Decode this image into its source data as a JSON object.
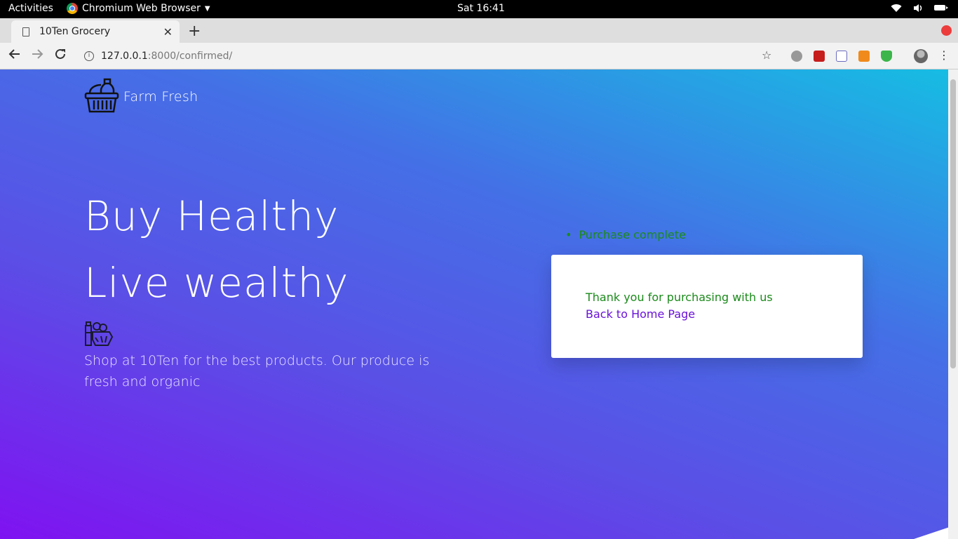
{
  "os_bar": {
    "activities": "Activities",
    "app_name": "Chromium Web Browser",
    "clock": "Sat 16:41"
  },
  "browser": {
    "tab_title": "10Ten Grocery",
    "url_host": "127.0.0.1",
    "url_path": ":8000/confirmed/"
  },
  "page": {
    "brand": "Farm Fresh",
    "headline_1": "Buy Healthy",
    "headline_2": "Live wealthy",
    "tagline": "Shop at 10Ten for the best products. Our produce is fresh and organic",
    "message": "Purchase complete",
    "thanks": "Thank you for purchasing with us",
    "home_link": "Back to Home Page"
  },
  "colors": {
    "gradient_top_right": "#16bde3",
    "gradient_bottom_left": "#7f12f1",
    "success_text": "#1b8a1b",
    "link": "#6a12d8"
  },
  "icons": [
    "basket-icon",
    "groceries-icon",
    "chrome-icon",
    "wifi-icon",
    "volume-icon",
    "battery-icon"
  ]
}
